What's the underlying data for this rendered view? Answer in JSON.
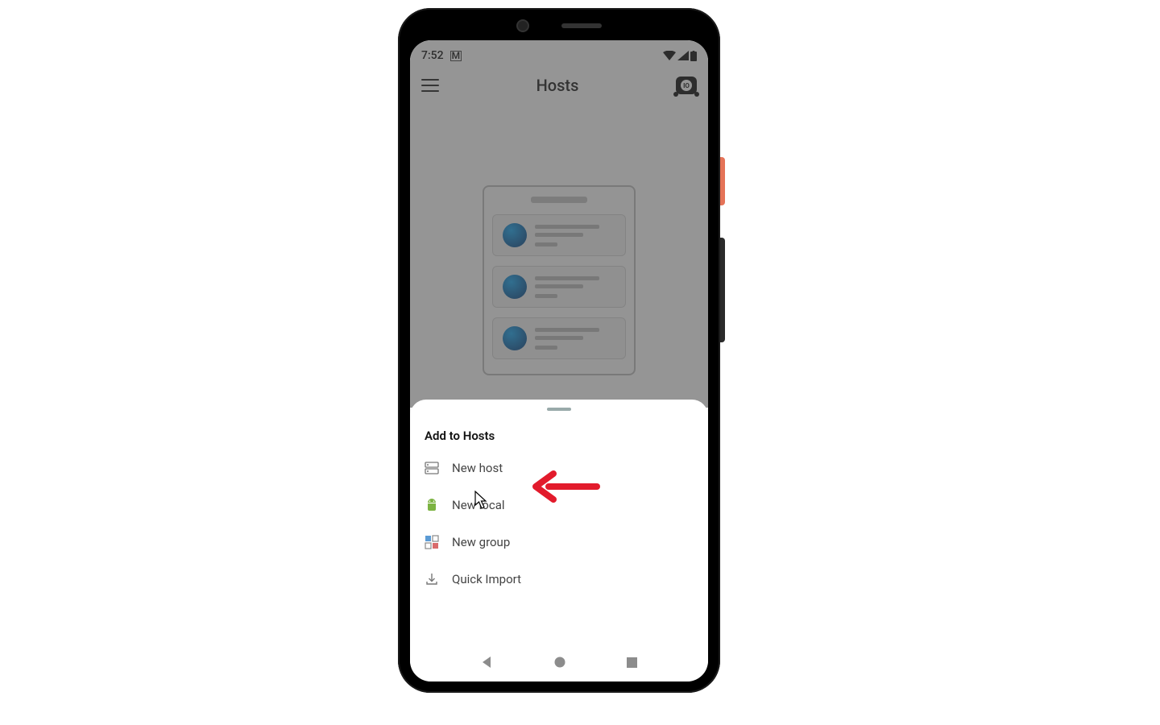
{
  "statusbar": {
    "time": "7:52",
    "notif_icon": "M"
  },
  "header": {
    "title": "Hosts"
  },
  "sheet": {
    "title": "Add to Hosts",
    "items": [
      {
        "label": "New host"
      },
      {
        "label": "New local"
      },
      {
        "label": "New group"
      },
      {
        "label": "Quick Import"
      }
    ]
  },
  "colors": {
    "annotation": "#e21b2c"
  }
}
